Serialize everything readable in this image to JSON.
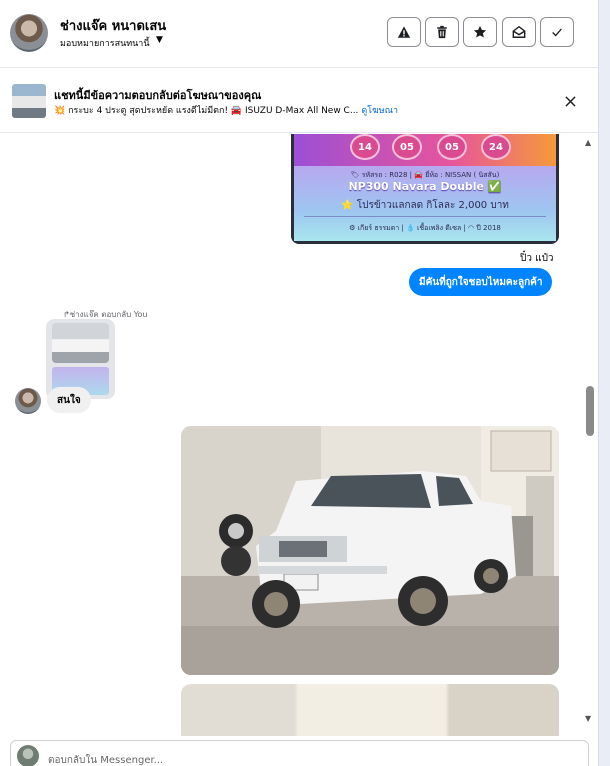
{
  "header": {
    "contact_name": "ช่างแจ๊ค หนาดเสน",
    "assign_label": "มอบหมายการสนทนานี้",
    "actions": [
      {
        "name": "report-button",
        "icon": "warning-icon"
      },
      {
        "name": "delete-button",
        "icon": "trash-icon"
      },
      {
        "name": "star-button",
        "icon": "star-icon"
      },
      {
        "name": "mark-unread-button",
        "icon": "envelope-open-icon"
      },
      {
        "name": "mark-done-button",
        "icon": "check-icon"
      }
    ]
  },
  "ad_banner": {
    "title": "แชทนี้มีข้อความตอบกลับต่อโฆษณาของคุณ",
    "text": "💥 กระบะ 4 ประตู สุดประหยัด แรงดีไม่มีตก! 🚘 ISUZU D-Max All New C...",
    "link": "ดูโฆษณา"
  },
  "promo_card": {
    "boxes": [
      "14",
      "05",
      "05",
      "24"
    ],
    "code_line": "🏷 รหัสรถ : R028 | 🚘 ยี่ห้อ : NISSAN ( นิสสัน)",
    "model": "NP300 Navara Double ✅",
    "offer": "⭐ โปรข้าวแลกลด กิโลละ 2,000 บาท",
    "specs": "⚙ เกียร์ ธรรมดา  |  💧 เชื้อเพลิง ดีเซล  |  ◠ ปี 2018"
  },
  "messages": {
    "outgoing_sender": "ปิ๋ว แป๋ว",
    "outgoing_text": "มีคันที่ถูกใจชอบไหมคะลูกค้า",
    "reply_label": "↱ช่างแจ๊ค ตอบกลับ You",
    "incoming_text": "สนใจ"
  },
  "composer": {
    "placeholder": "ตอบกลับใน Messenger..."
  },
  "colors": {
    "messenger_blue": "#0084ff",
    "link_blue": "#0064d1",
    "incoming_bubble": "#f0f0f0"
  }
}
